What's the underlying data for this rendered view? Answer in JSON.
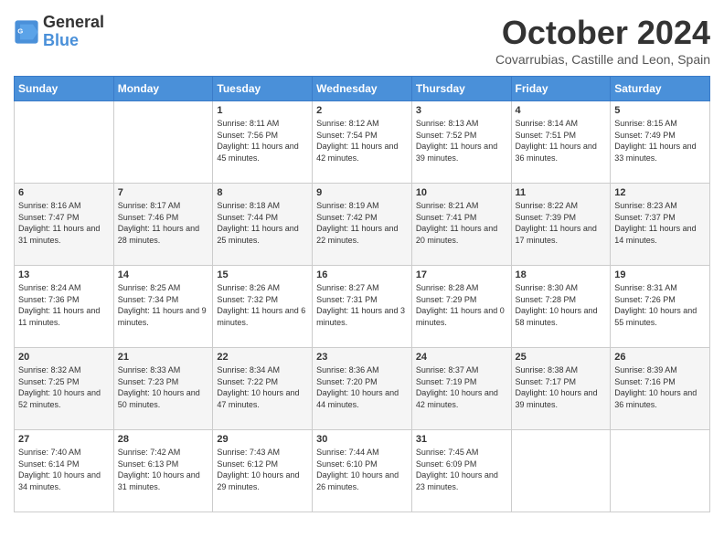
{
  "header": {
    "logo_line1": "General",
    "logo_line2": "Blue",
    "month": "October 2024",
    "location": "Covarrubias, Castille and Leon, Spain"
  },
  "weekdays": [
    "Sunday",
    "Monday",
    "Tuesday",
    "Wednesday",
    "Thursday",
    "Friday",
    "Saturday"
  ],
  "weeks": [
    [
      {
        "day": "",
        "info": ""
      },
      {
        "day": "",
        "info": ""
      },
      {
        "day": "1",
        "info": "Sunrise: 8:11 AM\nSunset: 7:56 PM\nDaylight: 11 hours and 45 minutes."
      },
      {
        "day": "2",
        "info": "Sunrise: 8:12 AM\nSunset: 7:54 PM\nDaylight: 11 hours and 42 minutes."
      },
      {
        "day": "3",
        "info": "Sunrise: 8:13 AM\nSunset: 7:52 PM\nDaylight: 11 hours and 39 minutes."
      },
      {
        "day": "4",
        "info": "Sunrise: 8:14 AM\nSunset: 7:51 PM\nDaylight: 11 hours and 36 minutes."
      },
      {
        "day": "5",
        "info": "Sunrise: 8:15 AM\nSunset: 7:49 PM\nDaylight: 11 hours and 33 minutes."
      }
    ],
    [
      {
        "day": "6",
        "info": "Sunrise: 8:16 AM\nSunset: 7:47 PM\nDaylight: 11 hours and 31 minutes."
      },
      {
        "day": "7",
        "info": "Sunrise: 8:17 AM\nSunset: 7:46 PM\nDaylight: 11 hours and 28 minutes."
      },
      {
        "day": "8",
        "info": "Sunrise: 8:18 AM\nSunset: 7:44 PM\nDaylight: 11 hours and 25 minutes."
      },
      {
        "day": "9",
        "info": "Sunrise: 8:19 AM\nSunset: 7:42 PM\nDaylight: 11 hours and 22 minutes."
      },
      {
        "day": "10",
        "info": "Sunrise: 8:21 AM\nSunset: 7:41 PM\nDaylight: 11 hours and 20 minutes."
      },
      {
        "day": "11",
        "info": "Sunrise: 8:22 AM\nSunset: 7:39 PM\nDaylight: 11 hours and 17 minutes."
      },
      {
        "day": "12",
        "info": "Sunrise: 8:23 AM\nSunset: 7:37 PM\nDaylight: 11 hours and 14 minutes."
      }
    ],
    [
      {
        "day": "13",
        "info": "Sunrise: 8:24 AM\nSunset: 7:36 PM\nDaylight: 11 hours and 11 minutes."
      },
      {
        "day": "14",
        "info": "Sunrise: 8:25 AM\nSunset: 7:34 PM\nDaylight: 11 hours and 9 minutes."
      },
      {
        "day": "15",
        "info": "Sunrise: 8:26 AM\nSunset: 7:32 PM\nDaylight: 11 hours and 6 minutes."
      },
      {
        "day": "16",
        "info": "Sunrise: 8:27 AM\nSunset: 7:31 PM\nDaylight: 11 hours and 3 minutes."
      },
      {
        "day": "17",
        "info": "Sunrise: 8:28 AM\nSunset: 7:29 PM\nDaylight: 11 hours and 0 minutes."
      },
      {
        "day": "18",
        "info": "Sunrise: 8:30 AM\nSunset: 7:28 PM\nDaylight: 10 hours and 58 minutes."
      },
      {
        "day": "19",
        "info": "Sunrise: 8:31 AM\nSunset: 7:26 PM\nDaylight: 10 hours and 55 minutes."
      }
    ],
    [
      {
        "day": "20",
        "info": "Sunrise: 8:32 AM\nSunset: 7:25 PM\nDaylight: 10 hours and 52 minutes."
      },
      {
        "day": "21",
        "info": "Sunrise: 8:33 AM\nSunset: 7:23 PM\nDaylight: 10 hours and 50 minutes."
      },
      {
        "day": "22",
        "info": "Sunrise: 8:34 AM\nSunset: 7:22 PM\nDaylight: 10 hours and 47 minutes."
      },
      {
        "day": "23",
        "info": "Sunrise: 8:36 AM\nSunset: 7:20 PM\nDaylight: 10 hours and 44 minutes."
      },
      {
        "day": "24",
        "info": "Sunrise: 8:37 AM\nSunset: 7:19 PM\nDaylight: 10 hours and 42 minutes."
      },
      {
        "day": "25",
        "info": "Sunrise: 8:38 AM\nSunset: 7:17 PM\nDaylight: 10 hours and 39 minutes."
      },
      {
        "day": "26",
        "info": "Sunrise: 8:39 AM\nSunset: 7:16 PM\nDaylight: 10 hours and 36 minutes."
      }
    ],
    [
      {
        "day": "27",
        "info": "Sunrise: 7:40 AM\nSunset: 6:14 PM\nDaylight: 10 hours and 34 minutes."
      },
      {
        "day": "28",
        "info": "Sunrise: 7:42 AM\nSunset: 6:13 PM\nDaylight: 10 hours and 31 minutes."
      },
      {
        "day": "29",
        "info": "Sunrise: 7:43 AM\nSunset: 6:12 PM\nDaylight: 10 hours and 29 minutes."
      },
      {
        "day": "30",
        "info": "Sunrise: 7:44 AM\nSunset: 6:10 PM\nDaylight: 10 hours and 26 minutes."
      },
      {
        "day": "31",
        "info": "Sunrise: 7:45 AM\nSunset: 6:09 PM\nDaylight: 10 hours and 23 minutes."
      },
      {
        "day": "",
        "info": ""
      },
      {
        "day": "",
        "info": ""
      }
    ]
  ]
}
